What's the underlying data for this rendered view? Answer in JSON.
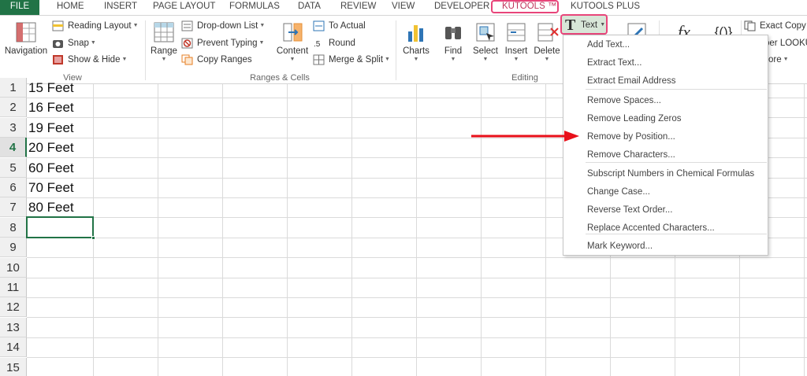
{
  "tabs": [
    "FILE",
    "HOME",
    "INSERT",
    "PAGE LAYOUT",
    "FORMULAS",
    "DATA",
    "REVIEW",
    "DEVELOPER",
    "KUTOOLS ™",
    "KUTOOLS PLUS"
  ],
  "ribbon": {
    "view_group": {
      "navigation": "Navigation",
      "reading_layout": "Reading Layout",
      "snap": "Snap",
      "show_hide": "Show & Hide",
      "label": "View"
    },
    "ranges_group": {
      "range": "Range",
      "dropdown_list": "Drop-down List",
      "prevent_typing": "Prevent Typing",
      "copy_ranges": "Copy Ranges",
      "content": "Content",
      "to_actual": "To Actual",
      "round": "Round",
      "merge_split": "Merge & Split",
      "label": "Ranges & Cells"
    },
    "editing_group": {
      "charts": "Charts",
      "find": "Find",
      "select": "Select",
      "insert": "Insert",
      "delete": "Delete",
      "text": "Text",
      "label": "Editing"
    },
    "formula_group": {
      "fx": "fx",
      "braces": "{()}",
      "exact_copy": "Exact Copy",
      "super_lookup": "per LOOKU",
      "more": "ore"
    }
  },
  "grid": {
    "rows": [
      "1",
      "2",
      "3",
      "4",
      "5",
      "6",
      "7",
      "8",
      "9",
      "10",
      "11",
      "12",
      "13",
      "14",
      "15"
    ],
    "cells": [
      "15 Feet",
      "16 Feet",
      "19 Feet",
      "20 Feet",
      "60 Feet",
      "70 Feet",
      "80 Feet"
    ],
    "active_row": "4"
  },
  "text_menu": {
    "items": [
      "Add Text...",
      "Extract Text...",
      "Extract Email Address",
      "Remove Spaces...",
      "Remove Leading Zeros",
      "Remove by Position...",
      "Remove Characters...",
      "Subscript Numbers in Chemical Formulas",
      "Change Case...",
      "Reverse Text Order...",
      "Replace Accented Characters...",
      "Mark Keyword..."
    ]
  },
  "colors": {
    "excel_green": "#217346",
    "highlight_pink": "#e8457a",
    "arrow_red": "#e8101a"
  }
}
